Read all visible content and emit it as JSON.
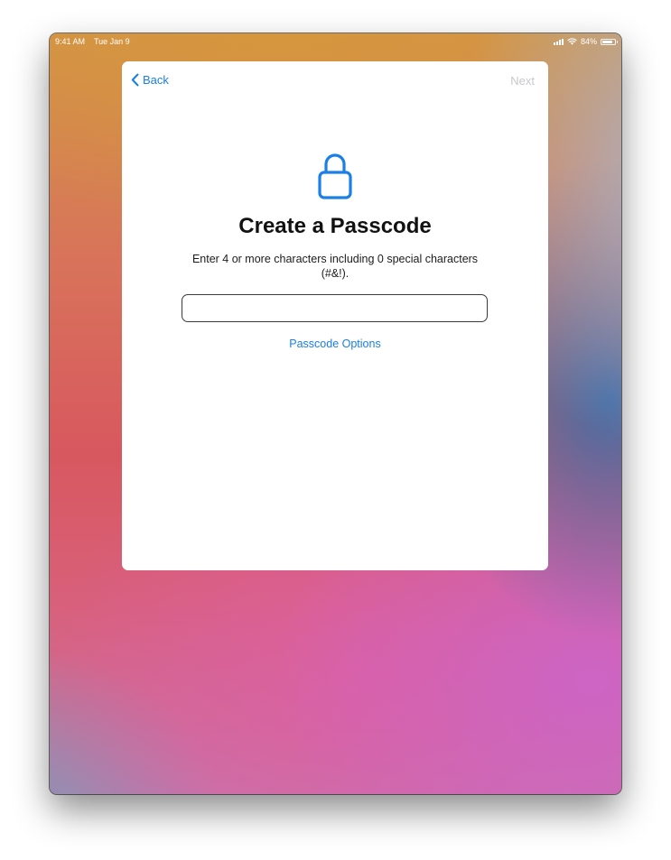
{
  "status_bar": {
    "time": "9:41 AM",
    "date": "Tue Jan 9",
    "battery_text": "84%",
    "battery_level": 0.84,
    "icons": [
      "signal-icon",
      "wifi-icon",
      "battery-icon"
    ]
  },
  "nav": {
    "back_label": "Back",
    "next_label": "Next",
    "back_icon": "chevron-left-icon"
  },
  "main": {
    "lock_icon": "lock-icon",
    "title": "Create a Passcode",
    "subtitle": "Enter 4 or more characters including 0 special characters (#&!).",
    "passcode_value": "",
    "options_label": "Passcode Options"
  },
  "colors": {
    "accent": "#1a7fe6",
    "disabled": "#c8c8cc",
    "title": "#111111"
  }
}
